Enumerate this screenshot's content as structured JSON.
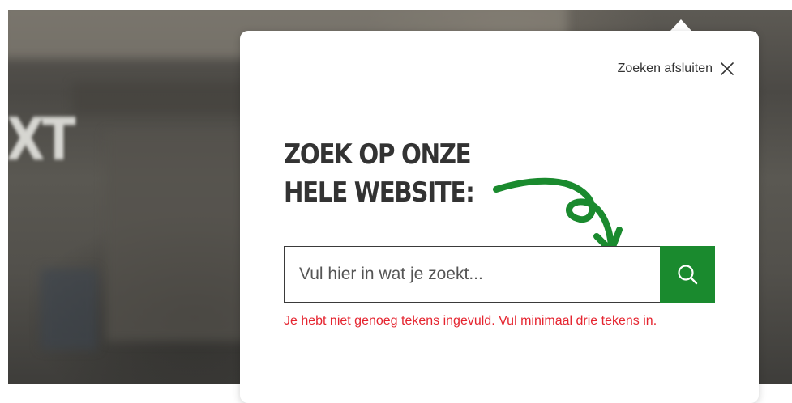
{
  "background": {
    "text": "XT"
  },
  "search_panel": {
    "close_label": "Zoeken afsluiten",
    "close_icon": "close-icon",
    "heading_lines": [
      "ZOEK OP ONZE",
      "HELE WEBSITE:"
    ],
    "search": {
      "placeholder": "Vul hier in wat je zoekt...",
      "value": "",
      "button_icon": "search-icon"
    },
    "error_message": "Je hebt niet genoeg tekens ingevuld. Vul minimaal drie tekens in."
  },
  "colors": {
    "accent_green": "#1a8a2e",
    "error_red": "#e5242f",
    "heading": "#333333"
  }
}
